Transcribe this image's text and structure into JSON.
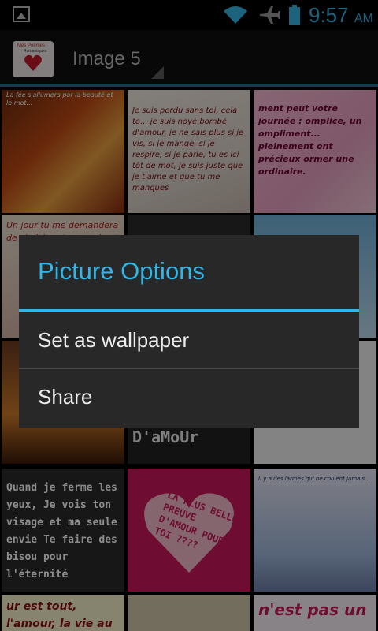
{
  "status_bar": {
    "time": "9:57",
    "ampm": "AM",
    "icons": [
      "image-notification-icon",
      "wifi-icon",
      "airplane-mode-icon",
      "battery-icon"
    ]
  },
  "action_bar": {
    "title": "Image 5",
    "app_icon_text": "Mes Poèmes",
    "app_icon_subtext": "Romantiques"
  },
  "grid": {
    "tile_texts": [
      "La fée s'allumera par la beauté et le mot...",
      "Je suis perdu sans toi, cela te... je suis noyé bombé d'amour, je ne sais plus si je vis, si je mange, si je respire, si je parle, tu es ici tôt de mot, je suis juste que je t'aime et que tu me manques",
      "ment peut votre journée : omplice, un ompliment... pleinement ont précieux ormer une ordinaire.",
      "Un jour tu me demandera de choisir entre ma vie et",
      "",
      "",
      "",
      "UnE PreuvE D'aMoUr",
      "",
      "Quand je ferme les yeux, Je vois ton visage et ma seule envie Te faire des bisou pour l'éternité",
      "LA PLUS BELLE PREUVE D'AMOUR POUR TOI ????",
      "Il y a des larmes qui ne coulent jamais...",
      "ur est tout, l'amour, la vie au soleil.",
      "",
      "n'est pas un"
    ]
  },
  "dialog": {
    "title": "Picture Options",
    "items": [
      {
        "label": "Set as wallpaper"
      },
      {
        "label": "Share"
      }
    ]
  },
  "colors": {
    "accent": "#33b5e5",
    "dialog_bg": "#282828",
    "action_bar_bg": "#0f0f0f"
  }
}
